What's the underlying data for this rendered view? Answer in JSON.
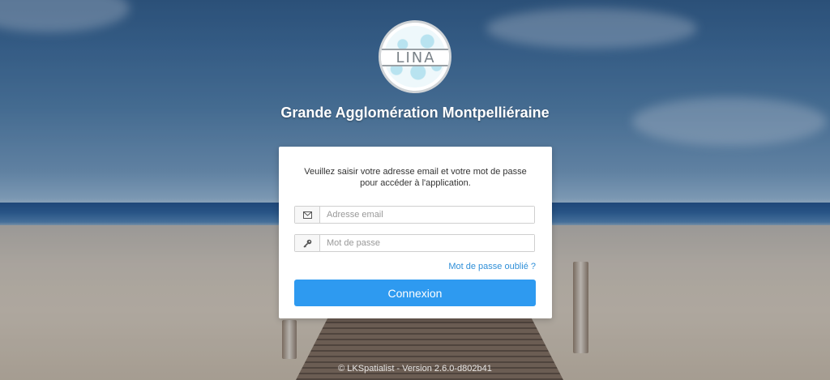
{
  "branding": {
    "logo_text": "LINA",
    "organization": "Grande Agglomération Montpelliéraine"
  },
  "login": {
    "intro": "Veuillez saisir votre adresse email et votre mot de passe pour accéder à l'application.",
    "email": {
      "value": "",
      "placeholder": "Adresse email",
      "icon": "envelope-icon"
    },
    "password": {
      "value": "",
      "placeholder": "Mot de passe",
      "icon": "key-icon"
    },
    "forgot_label": "Mot de passe oublié ?",
    "submit_label": "Connexion"
  },
  "footer": {
    "text": "© LKSpatialist - Version 2.6.0-d802b41"
  },
  "colors": {
    "accent": "#2e9af0",
    "link": "#2f8fd8"
  }
}
